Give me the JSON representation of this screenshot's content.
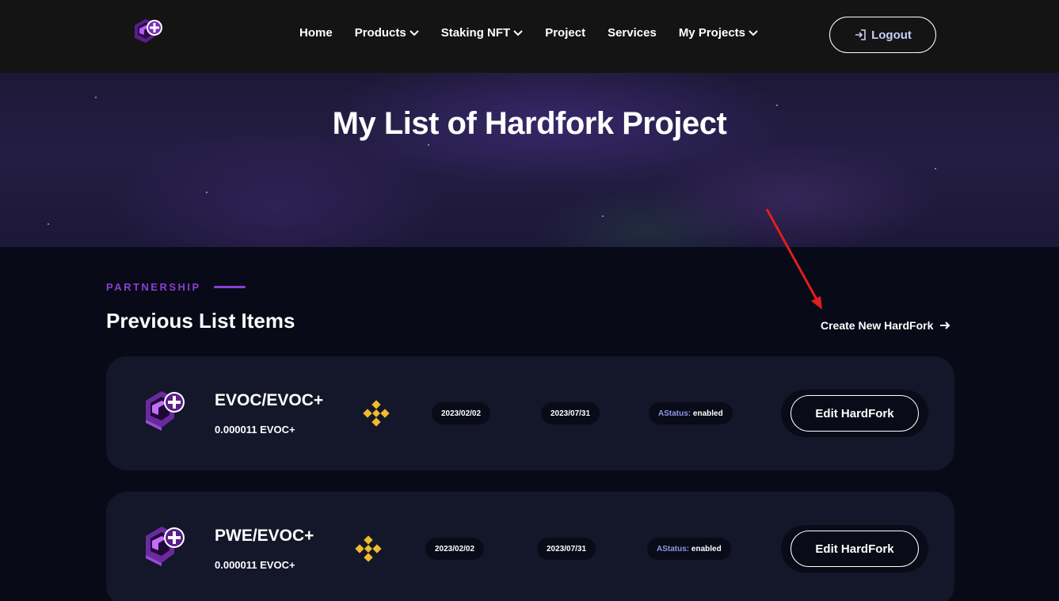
{
  "nav": {
    "items": [
      {
        "label": "Home",
        "has_dropdown": false
      },
      {
        "label": "Products",
        "has_dropdown": true
      },
      {
        "label": "Staking NFT",
        "has_dropdown": true
      },
      {
        "label": "Project",
        "has_dropdown": false
      },
      {
        "label": "Services",
        "has_dropdown": false
      },
      {
        "label": "My Projects",
        "has_dropdown": true
      }
    ],
    "logout_label": "Logout"
  },
  "hero": {
    "title": "My List of Hardfork Project"
  },
  "section": {
    "eyebrow": "PARTNERSHIP",
    "title": "Previous List Items",
    "create_label": "Create New HardFork"
  },
  "items": [
    {
      "pair": "EVOC/EVOC+",
      "amount": "0.000011 EVOC+",
      "chain_icon": "binance-icon",
      "start_date": "2023/02/02",
      "end_date": "2023/07/31",
      "status_label": "AStatus:",
      "status_value": "enabled",
      "edit_label": "Edit HardFork"
    },
    {
      "pair": "PWE/EVOC+",
      "amount": "0.000011 EVOC+",
      "chain_icon": "binance-icon",
      "start_date": "2023/02/02",
      "end_date": "2023/07/31",
      "status_label": "AStatus:",
      "status_value": "enabled",
      "edit_label": "Edit HardFork"
    }
  ],
  "colors": {
    "accent": "#8a3fd1",
    "binance": "#f3ba2f",
    "annotation_arrow": "#e01e1e",
    "logout_text": "#c9cdf5"
  }
}
